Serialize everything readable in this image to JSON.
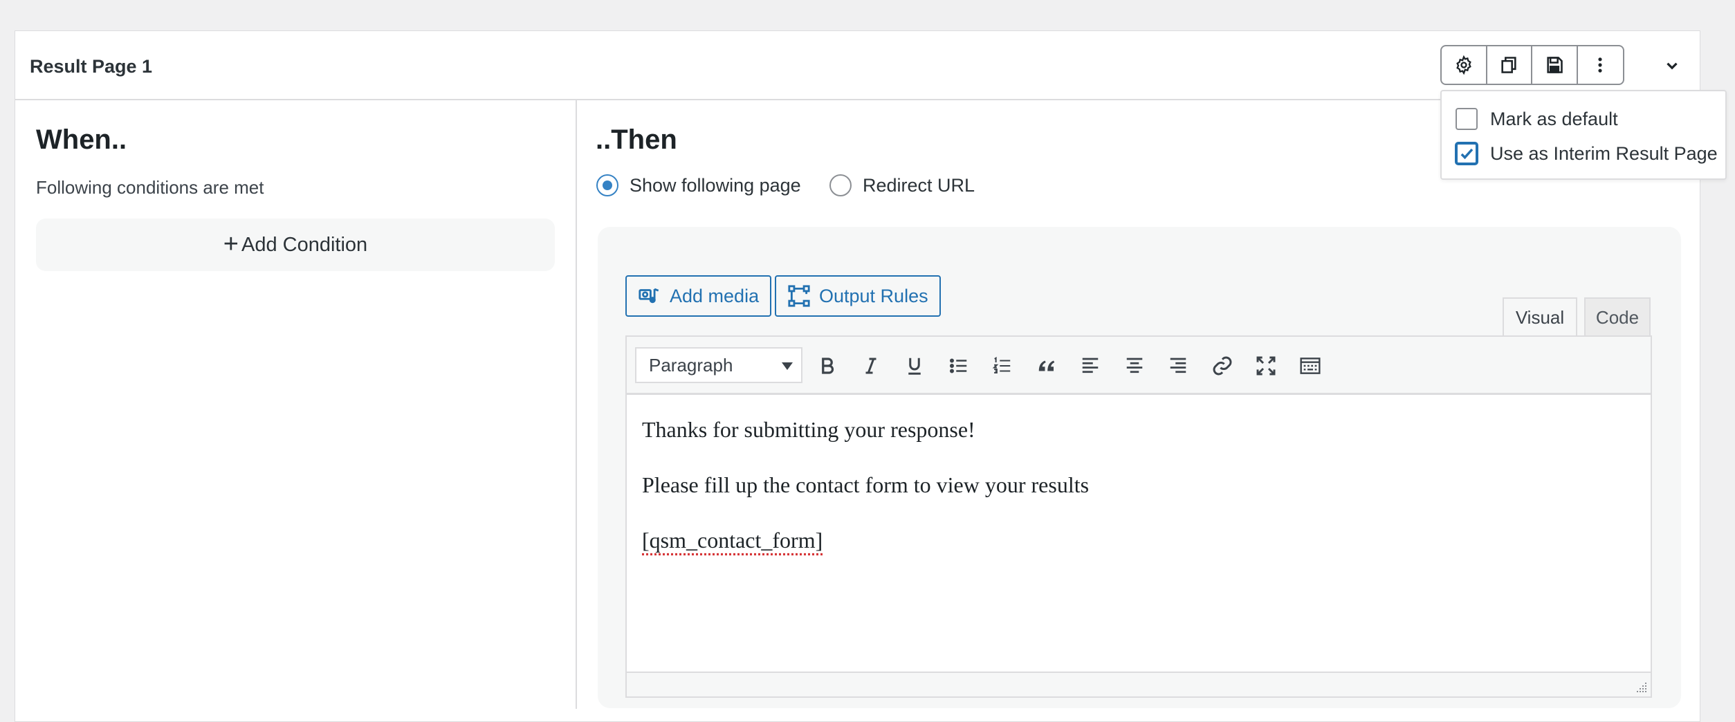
{
  "panel": {
    "title": "Result Page 1",
    "toolbar": {
      "settings_icon": "gear-icon",
      "duplicate_icon": "copy-icon",
      "save_icon": "floppy-disk-icon",
      "more_icon": "vertical-ellipsis-icon",
      "collapse_icon": "chevron-down-icon"
    }
  },
  "dropdown": {
    "items": [
      {
        "label": "Mark as default",
        "checked": false
      },
      {
        "label": "Use as Interim Result Page",
        "checked": true
      }
    ]
  },
  "when": {
    "title": "When..",
    "subtitle": "Following conditions are met",
    "add_condition_plus": "+",
    "add_condition_label": "Add Condition"
  },
  "then": {
    "title": "..Then",
    "options": [
      {
        "label": "Show following page",
        "selected": true
      },
      {
        "label": "Redirect URL",
        "selected": false
      }
    ]
  },
  "editor": {
    "add_media_label": "Add media",
    "output_rules_label": "Output Rules",
    "tabs": {
      "visual": "Visual",
      "code": "Code"
    },
    "format_select": "Paragraph",
    "toolbar_icons": [
      "bold-icon",
      "italic-icon",
      "underline-icon",
      "bulleted-list-icon",
      "numbered-list-icon",
      "blockquote-icon",
      "align-left-icon",
      "align-center-icon",
      "align-right-icon",
      "link-icon",
      "fullscreen-icon",
      "toolbar-toggle-icon"
    ],
    "content": {
      "line1": "Thanks for submitting your response!",
      "line2": "Please fill up the contact form to view your results",
      "line3": "[qsm_contact_form]"
    }
  },
  "colors": {
    "accent": "#2271b1",
    "radio_accent": "#3582c4",
    "page_bg": "#f0f0f1"
  }
}
